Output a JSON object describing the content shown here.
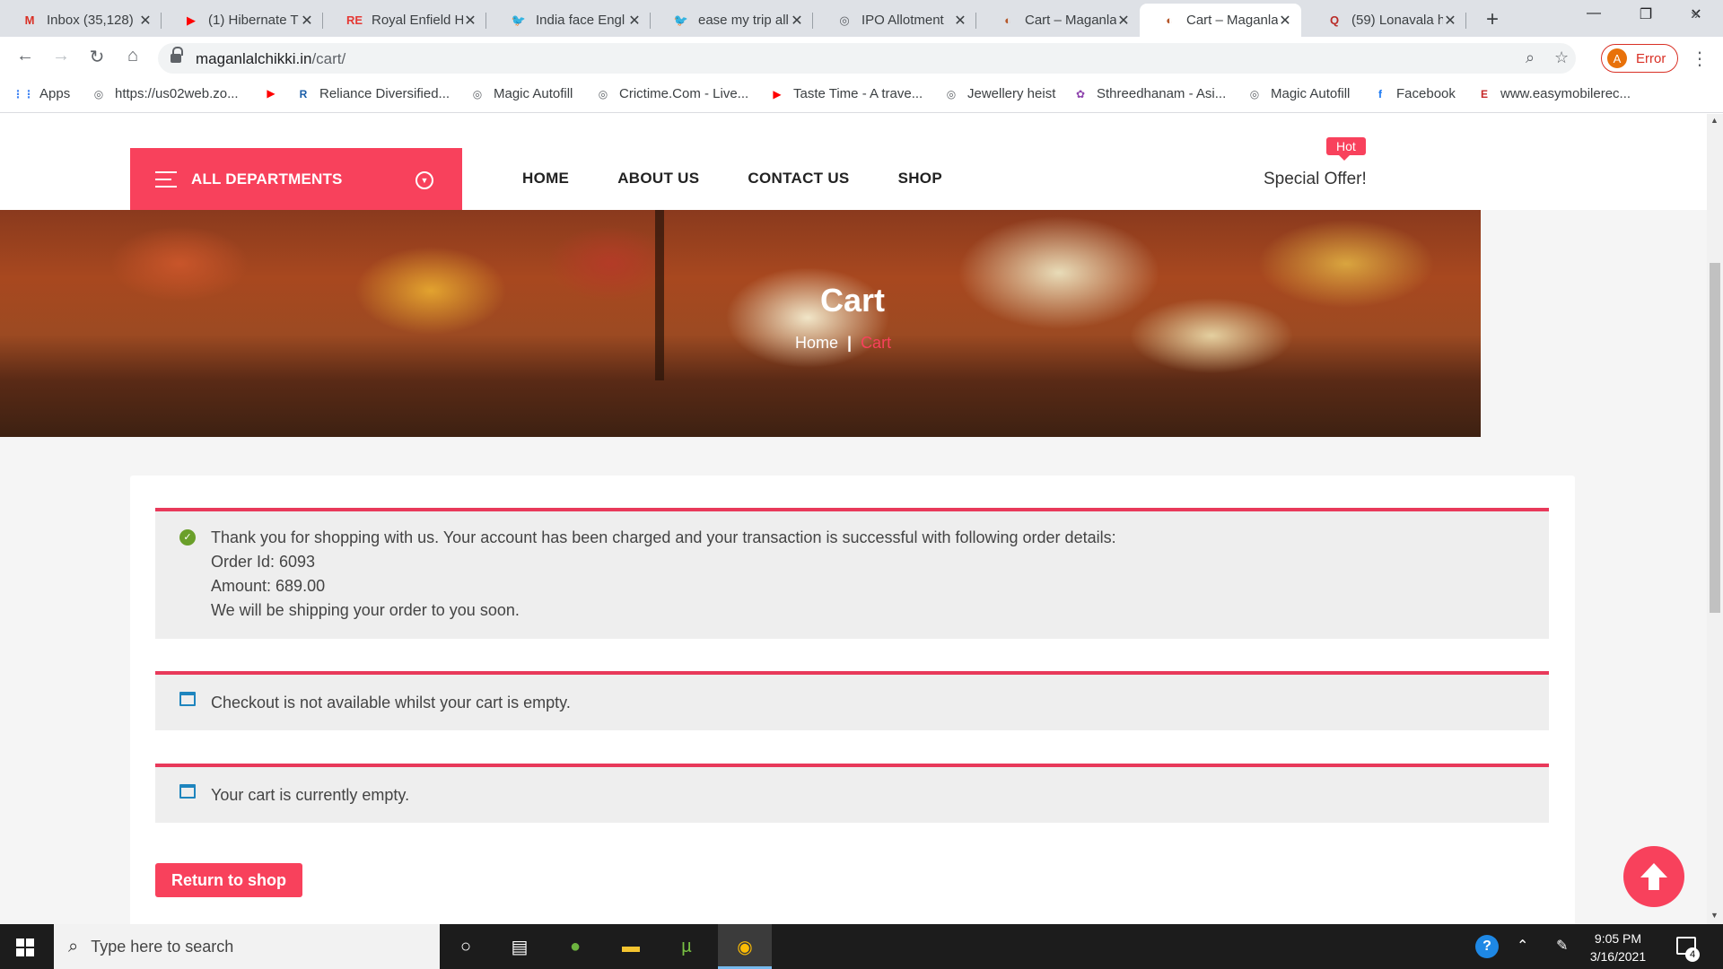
{
  "browser": {
    "tabs": [
      {
        "title": "Inbox (35,128)",
        "icon": "gmail-icon",
        "color": "#d93025",
        "glyph": "M"
      },
      {
        "title": "(1) Hibernate T",
        "icon": "youtube-icon",
        "color": "#ff0000",
        "glyph": "▶"
      },
      {
        "title": "Royal Enfield H",
        "icon": "royal-enfield-icon",
        "color": "#e53935",
        "glyph": "RE"
      },
      {
        "title": "India face Engl",
        "icon": "twitter-icon",
        "color": "#1da1f2",
        "glyph": "🐦"
      },
      {
        "title": "ease my trip all",
        "icon": "twitter-icon",
        "color": "#1da1f2",
        "glyph": "🐦"
      },
      {
        "title": "IPO Allotment",
        "icon": "globe-icon",
        "color": "#5f6368",
        "glyph": "◎"
      },
      {
        "title": "Cart – Maganla",
        "icon": "maganlal-icon",
        "color": "#b5572a",
        "glyph": "◐"
      },
      {
        "title": "Cart – Maganla",
        "icon": "maganlal-icon",
        "color": "#b5572a",
        "glyph": "◐"
      },
      {
        "title": "(59) Lonavala h",
        "icon": "quora-icon",
        "color": "#b92b27",
        "glyph": "Q"
      }
    ],
    "active_tab_index": 7,
    "new_tab": "+",
    "url_domain": "maganlalchikki.in",
    "url_path": "/cart/",
    "profile_initial": "A",
    "profile_status": "Error",
    "bookmarks": [
      {
        "label": "Apps",
        "icon": "apps-grid-icon",
        "color": "#4285f4",
        "glyph": "⋮⋮"
      },
      {
        "label": "https://us02web.zo...",
        "icon": "globe-icon",
        "color": "#5f6368",
        "glyph": "◎"
      },
      {
        "label": "",
        "icon": "youtube-icon",
        "color": "#ff0000",
        "glyph": "▶"
      },
      {
        "label": "Reliance Diversified...",
        "icon": "reliance-icon",
        "color": "#1a5ea8",
        "glyph": "R"
      },
      {
        "label": "Magic Autofill",
        "icon": "globe-icon",
        "color": "#5f6368",
        "glyph": "◎"
      },
      {
        "label": "Crictime.Com - Live...",
        "icon": "globe-icon",
        "color": "#5f6368",
        "glyph": "◎"
      },
      {
        "label": "Taste Time - A trave...",
        "icon": "youtube-icon",
        "color": "#ff0000",
        "glyph": "▶"
      },
      {
        "label": "Jewellery heist",
        "icon": "globe-icon",
        "color": "#5f6368",
        "glyph": "◎"
      },
      {
        "label": "Sthreedhanam - Asi...",
        "icon": "sthreedhanam-icon",
        "color": "#8e44ad",
        "glyph": "✿"
      },
      {
        "label": "Magic Autofill",
        "icon": "globe-icon",
        "color": "#5f6368",
        "glyph": "◎"
      },
      {
        "label": "Facebook",
        "icon": "facebook-icon",
        "color": "#1877f2",
        "glyph": "f"
      },
      {
        "label": "www.easymobilerec...",
        "icon": "easymobile-icon",
        "color": "#c62828",
        "glyph": "E"
      }
    ],
    "bookmarks_overflow": "»"
  },
  "site": {
    "departments_label": "ALL DEPARTMENTS",
    "nav": [
      "HOME",
      "ABOUT US",
      "CONTACT US",
      "SHOP"
    ],
    "hot_badge": "Hot",
    "special_offer": "Special Offer!",
    "accent_color": "#f8415c",
    "banner_title": "Cart",
    "breadcrumb": {
      "home": "Home",
      "separator": "|",
      "current": "Cart"
    }
  },
  "notices": {
    "success": {
      "lines": [
        "Thank you for shopping with us. Your account has been charged and your transaction is successful with following order details:",
        "Order Id: 6093",
        "Amount: 689.00",
        "We will be shipping your order to you soon."
      ]
    },
    "checkout_unavailable": "Checkout is not available whilst your cart is empty.",
    "cart_empty": "Your cart is currently empty."
  },
  "return_to_shop": "Return to shop",
  "taskbar": {
    "search_placeholder": "Type here to search",
    "time": "9:05 PM",
    "date": "3/16/2021",
    "notification_count": "4"
  }
}
